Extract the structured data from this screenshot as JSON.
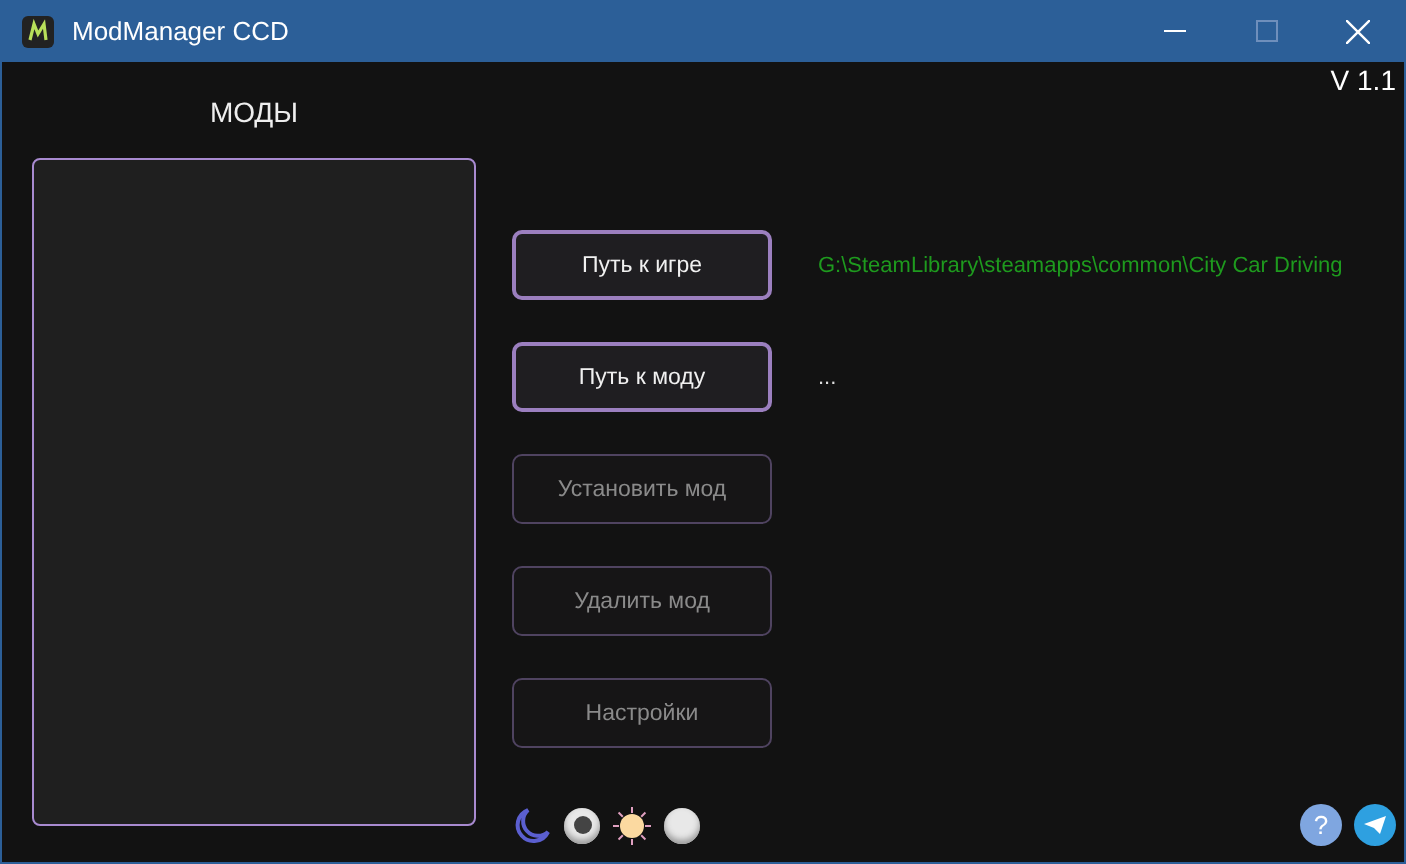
{
  "window": {
    "title": "ModManager CCD"
  },
  "version": "V 1.1",
  "mods_panel": {
    "title": "МОДЫ"
  },
  "actions": [
    {
      "label": "Путь к игре",
      "disabled": false,
      "path": {
        "text": "G:\\SteamLibrary\\steamapps\\common\\City Car Driving",
        "color": "#1e9a1e"
      }
    },
    {
      "label": "Путь к моду",
      "disabled": false,
      "path": {
        "text": "...",
        "color": "#dddddd"
      }
    },
    {
      "label": "Установить мод",
      "disabled": true
    },
    {
      "label": "Удалить мод",
      "disabled": true
    },
    {
      "label": "Настройки",
      "disabled": true
    }
  ],
  "themes": [
    {
      "kind": "dark",
      "selected": true
    },
    {
      "kind": "light",
      "selected": false
    }
  ],
  "help": {
    "label": "?"
  }
}
